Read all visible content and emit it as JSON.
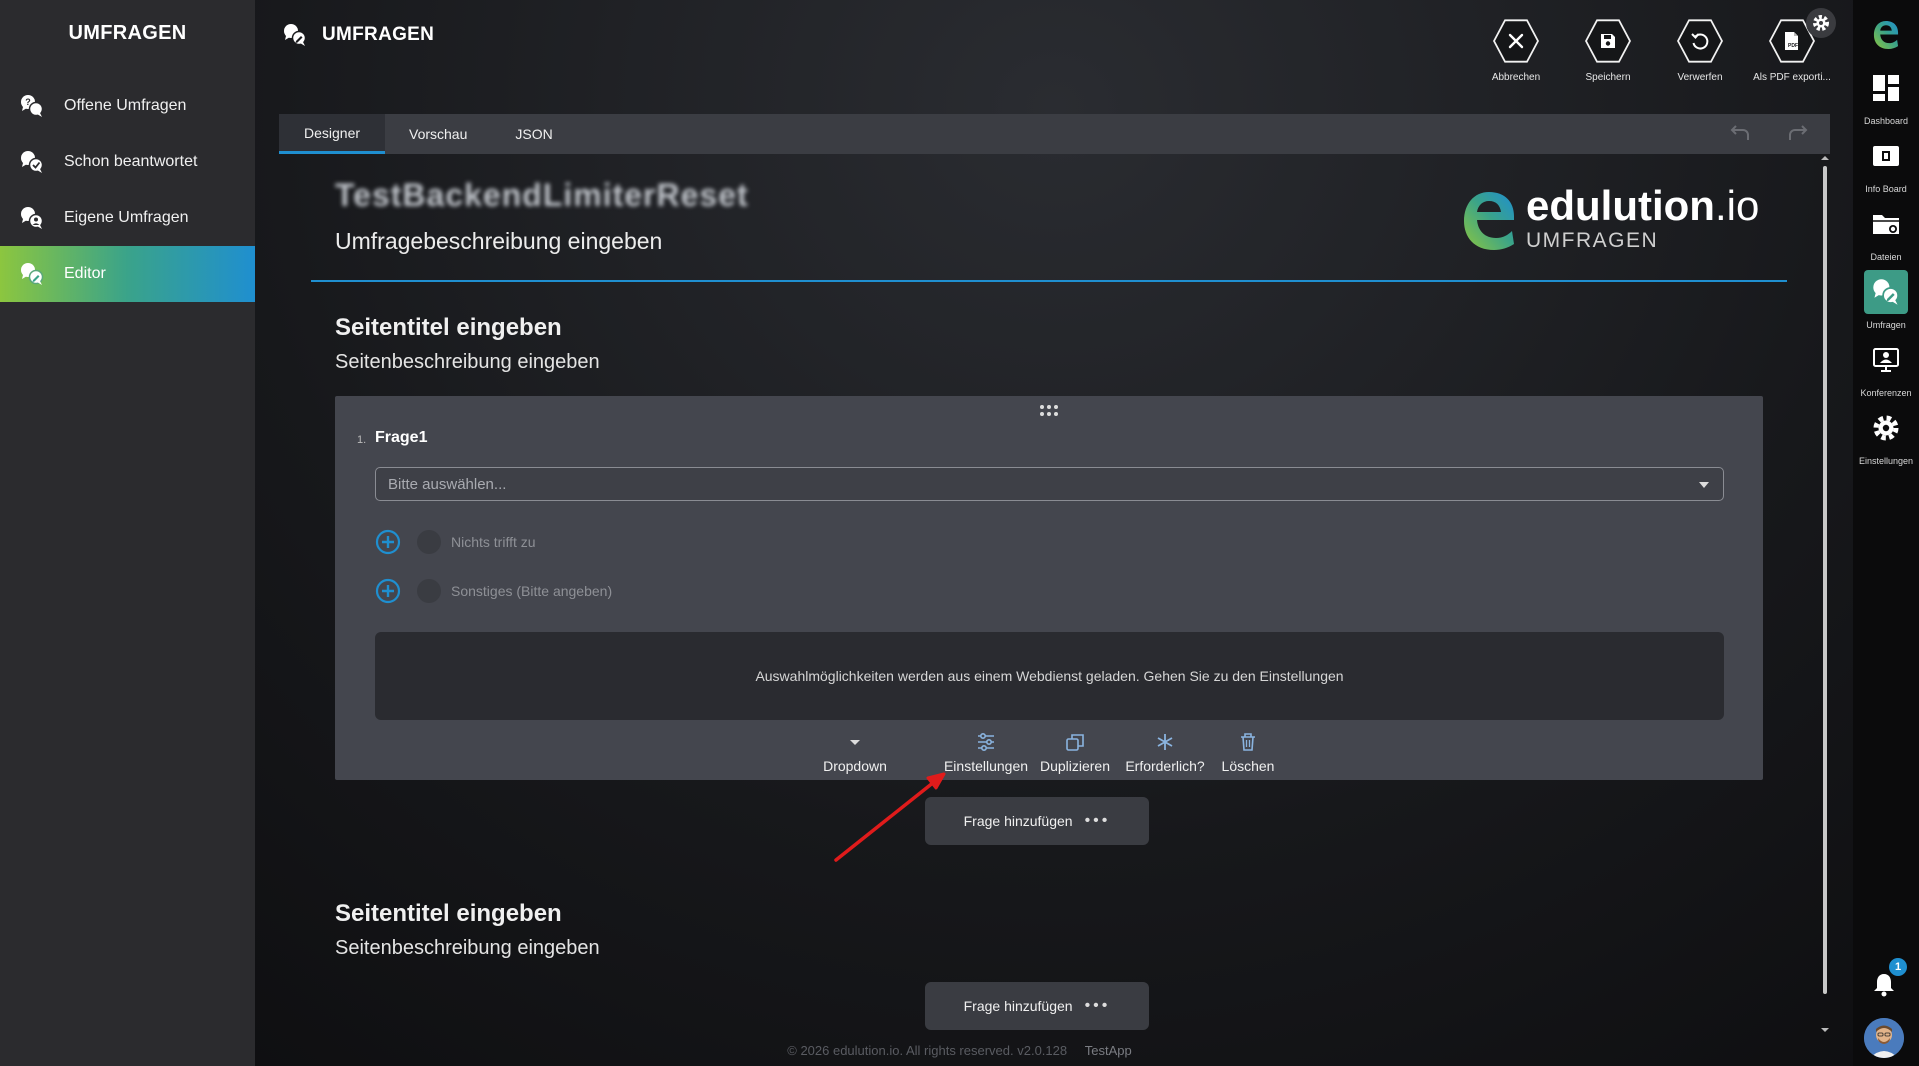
{
  "sidebar": {
    "title": "UMFRAGEN",
    "items": [
      {
        "label": "Offene Umfragen"
      },
      {
        "label": "Schon beantwortet"
      },
      {
        "label": "Eigene Umfragen"
      },
      {
        "label": "Editor"
      }
    ]
  },
  "header": {
    "title": "UMFRAGEN"
  },
  "toolbar": {
    "cancel": "Abbrechen",
    "save": "Speichern",
    "discard": "Verwerfen",
    "pdf": "Als PDF exporti..."
  },
  "tabs": [
    {
      "label": "Designer"
    },
    {
      "label": "Vorschau"
    },
    {
      "label": "JSON"
    }
  ],
  "survey": {
    "title": "TestBackendLimiterReset",
    "description": "Umfragebeschreibung eingeben",
    "logo": {
      "name": "edulution",
      "tld": ".io",
      "sub": "UMFRAGEN"
    }
  },
  "pages": [
    {
      "title": "Seitentitel eingeben",
      "description": "Seitenbeschreibung eingeben"
    },
    {
      "title": "Seitentitel eingeben",
      "description": "Seitenbeschreibung eingeben"
    }
  ],
  "question": {
    "number": "1.",
    "title": "Frage1",
    "placeholder": "Bitte auswählen...",
    "options": [
      {
        "label": "Nichts trifft zu"
      },
      {
        "label": "Sonstiges (Bitte angeben)"
      }
    ],
    "webservice_note": "Auswahlmöglichkeiten werden aus einem Webdienst geladen. Gehen Sie zu den Einstellungen",
    "actions": {
      "type": "Dropdown",
      "settings": "Einstellungen",
      "duplicate": "Duplizieren",
      "required": "Erforderlich?",
      "delete": "Löschen"
    }
  },
  "add_question": {
    "label": "Frage hinzufügen",
    "more": "•••"
  },
  "footer": {
    "text": "© 2026 edulution.io. All rights reserved. v2.0.128",
    "app": "TestApp"
  },
  "rail": {
    "items": [
      {
        "label": "Dashboard"
      },
      {
        "label": "Info Board"
      },
      {
        "label": "Dateien"
      },
      {
        "label": "Umfragen"
      },
      {
        "label": "Konferenzen"
      },
      {
        "label": "Einstellungen"
      }
    ],
    "notification_count": "1"
  },
  "colors": {
    "accent_blue": "#1f8fd0",
    "accent_green": "#8cc63f",
    "active_rail": "#3d9b86",
    "annotation_red": "#e01b1b"
  }
}
